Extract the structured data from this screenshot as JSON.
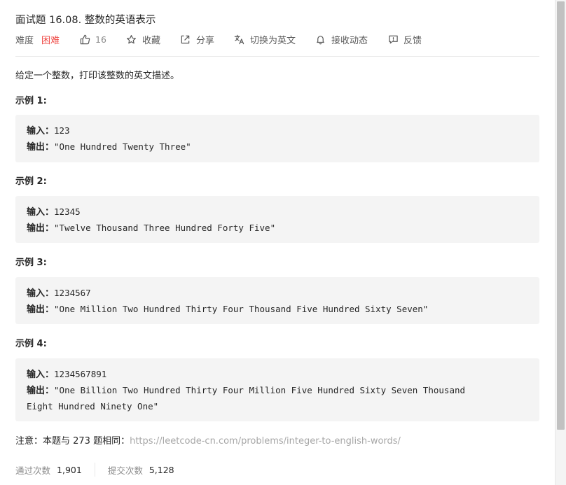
{
  "problem": {
    "title": "面试题 16.08. 整数的英语表示",
    "difficulty_label": "难度",
    "difficulty": "困难",
    "difficulty_color": "#ef4743",
    "likes": "16",
    "description": "给定一个整数，打印该整数的英文描述。"
  },
  "toolbar": {
    "favorite_label": "收藏",
    "share_label": "分享",
    "switch_lang_label": "切换为英文",
    "subscribe_label": "接收动态",
    "feedback_label": "反馈",
    "icons": [
      "thumbs-up-icon",
      "star-icon",
      "share-icon",
      "translate-icon",
      "bell-icon",
      "feedback-icon"
    ]
  },
  "examples": [
    {
      "title": "示例 1:",
      "input_label": "输入：",
      "input": "123",
      "output_label": "输出：",
      "output": "\"One Hundred Twenty Three\"",
      "output_cont": ""
    },
    {
      "title": "示例 2:",
      "input_label": "输入：",
      "input": "12345",
      "output_label": "输出：",
      "output": "\"Twelve Thousand Three Hundred Forty Five\"",
      "output_cont": ""
    },
    {
      "title": "示例 3:",
      "input_label": "输入：",
      "input": "1234567",
      "output_label": "输出：",
      "output": "\"One Million Two Hundred Thirty Four Thousand Five Hundred Sixty Seven\"",
      "output_cont": ""
    },
    {
      "title": "示例 4:",
      "input_label": "输入：",
      "input": "1234567891",
      "output_label": "输出：",
      "output": "\"One Billion Two Hundred Thirty Four Million Five Hundred Sixty Seven Thousand",
      "output_cont": "Eight Hundred Ninety One\""
    }
  ],
  "note": {
    "prefix": "注意：本题与 273 题相同：",
    "link": "https://leetcode-cn.com/problems/integer-to-english-words/"
  },
  "stats": {
    "accepted_label": "通过次数",
    "accepted": "1,901",
    "submissions_label": "提交次数",
    "submissions": "5,128"
  }
}
